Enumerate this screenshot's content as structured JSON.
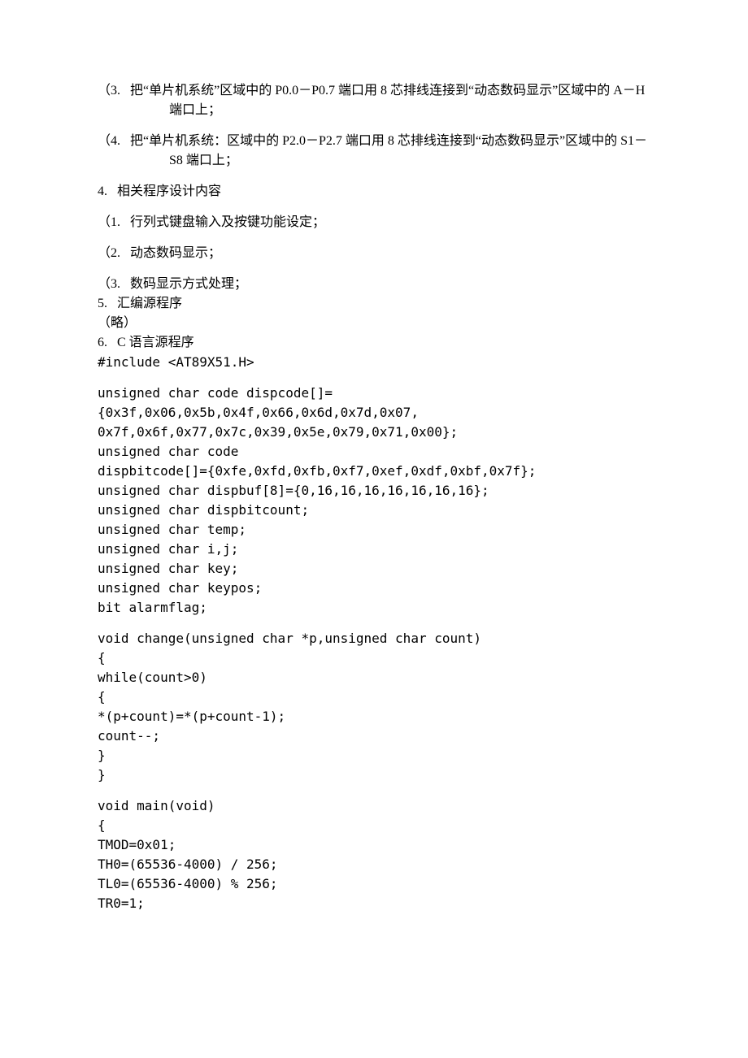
{
  "items": {
    "p3": "（3.   把“单片机系统”区域中的 P0.0－P0.7 端口用 8 芯排线连接到“动态数码显示”区域中的 A－H 端口上；",
    "p4": "（4.   把“单片机系统：区域中的 P2.0－P2.7 端口用 8 芯排线连接到“动态数码显示”区域中的 S1－S8 端口上；",
    "s4": "4.   相关程序设计内容",
    "s4_1": "（1.   行列式键盘输入及按键功能设定；",
    "s4_2": "（2.   动态数码显示；",
    "s4_3": "（3.   数码显示方式处理；",
    "s5": "5.   汇编源程序",
    "s5_1": "（略）",
    "s6": "6.   C 语言源程序",
    "c1": "#include <AT89X51.H>",
    "c2": "unsigned char code dispcode[]={0x3f,0x06,0x5b,0x4f,0x66,0x6d,0x7d,0x07,",
    "c3": "0x7f,0x6f,0x77,0x7c,0x39,0x5e,0x79,0x71,0x00};",
    "c4": "unsigned char code",
    "c5": "dispbitcode[]={0xfe,0xfd,0xfb,0xf7,0xef,0xdf,0xbf,0x7f};",
    "c6": "unsigned char dispbuf[8]={0,16,16,16,16,16,16,16};",
    "c7": "unsigned char dispbitcount;",
    "c8": "unsigned char temp;",
    "c9": "unsigned char i,j;",
    "c10": "unsigned char key;",
    "c11": "unsigned char keypos;",
    "c12": "bit alarmflag;",
    "c13": "void change(unsigned char *p,unsigned char count)",
    "c14": "{",
    "c15": "while(count>0)",
    "c16": "{",
    "c17": "*(p+count)=*(p+count-1);",
    "c18": "count--;",
    "c19": "}",
    "c20": "}",
    "c21": "void main(void)",
    "c22": "{",
    "c23": "TMOD=0x01;",
    "c24": "TH0=(65536-4000) / 256;",
    "c25": "TL0=(65536-4000) % 256;",
    "c26": "TR0=1;"
  }
}
